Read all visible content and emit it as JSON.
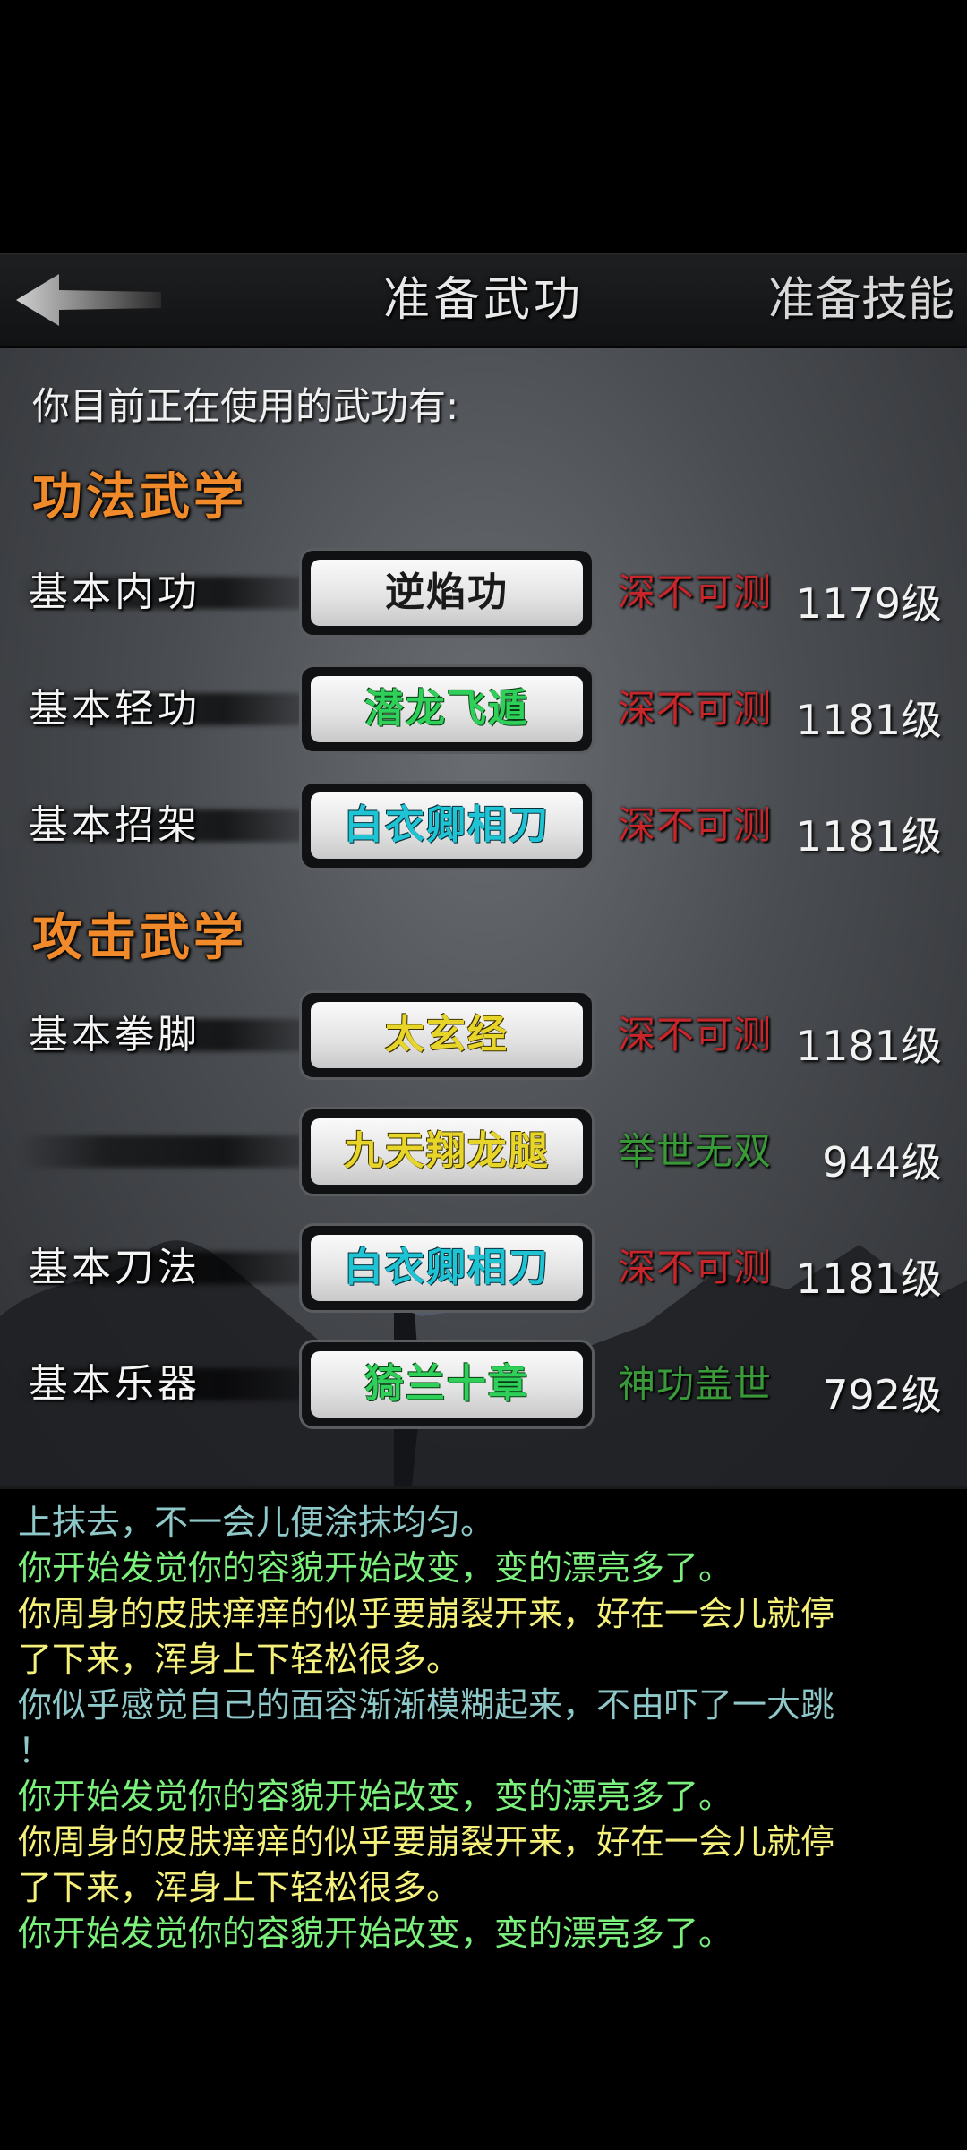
{
  "header": {
    "title": "准备武功",
    "right_label": "准备技能"
  },
  "intro": "你目前正在使用的武功有:",
  "sections": [
    {
      "title": "功法武学"
    },
    {
      "title": "攻击武学"
    }
  ],
  "rows": [
    {
      "label": "基本内功",
      "skill": "逆焰功",
      "rank": "深不可测",
      "level": "1179级"
    },
    {
      "label": "基本轻功",
      "skill": "潜龙飞遁",
      "rank": "深不可测",
      "level": "1181级"
    },
    {
      "label": "基本招架",
      "skill": "白衣卿相刀",
      "rank": "深不可测",
      "level": "1181级"
    },
    {
      "label": "基本拳脚",
      "skill": "太玄经",
      "rank": "深不可测",
      "level": "1181级"
    },
    {
      "label": "",
      "skill": "九天翔龙腿",
      "rank": "举世无双",
      "level": "944级"
    },
    {
      "label": "基本刀法",
      "skill": "白衣卿相刀",
      "rank": "深不可测",
      "level": "1181级"
    },
    {
      "label": "基本乐器",
      "skill": "猗兰十章",
      "rank": "神功盖世",
      "level": "792级"
    }
  ],
  "colors": {
    "skill_black": "#1a1a1a",
    "skill_green": "#2fd05a",
    "skill_cyan": "#1fc4d4",
    "skill_yellow": "#e8d52a",
    "rank_red": "#c8262a",
    "rank_green": "#3a9a3a",
    "log_white": "#dddddd",
    "log_green": "#7cf07c",
    "log_yellow": "#f4f07a",
    "log_teal": "#8fc8c8"
  },
  "log": [
    {
      "text": "上抹去，不一会儿便涂抹均匀。",
      "color": "#8fc8c8"
    },
    {
      "text": "你开始发觉你的容貌开始改变，变的漂亮多了。",
      "color": "#7cf07c"
    },
    {
      "text": "你周身的皮肤痒痒的似乎要崩裂开来，好在一会儿就停",
      "color": "#f4f07a"
    },
    {
      "text": "了下来，浑身上下轻松很多。",
      "color": "#f4f07a"
    },
    {
      "text": "你似乎感觉自己的面容渐渐模糊起来，不由吓了一大跳",
      "color": "#8fc8c8"
    },
    {
      "text": "！",
      "color": "#8fc8c8"
    },
    {
      "text": "你开始发觉你的容貌开始改变，变的漂亮多了。",
      "color": "#7cf07c"
    },
    {
      "text": "你周身的皮肤痒痒的似乎要崩裂开来，好在一会儿就停",
      "color": "#f4f07a"
    },
    {
      "text": "了下来，浑身上下轻松很多。",
      "color": "#f4f07a"
    },
    {
      "text": "你开始发觉你的容貌开始改变，变的漂亮多了。",
      "color": "#7cf07c"
    }
  ]
}
